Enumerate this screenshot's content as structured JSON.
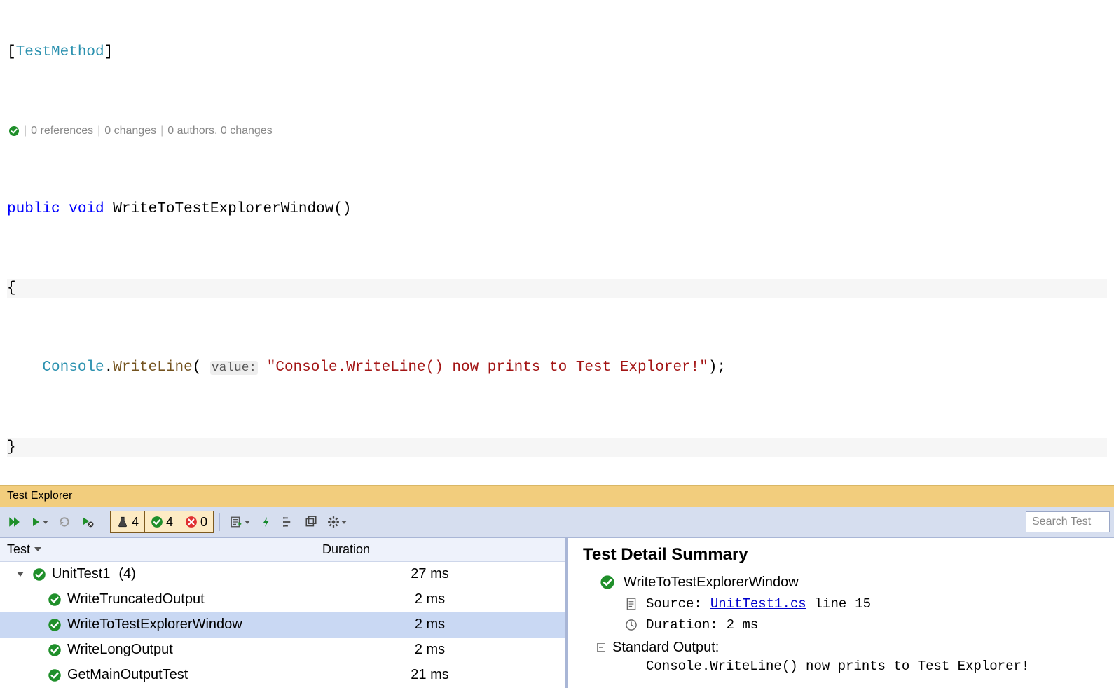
{
  "code": {
    "attribute": "TestMethod",
    "codelens": {
      "references": "0 references",
      "changes1": "0 changes",
      "authors": "0 authors, 0 changes"
    },
    "keyword_public": "public",
    "keyword_void": "void",
    "method_name": "WriteToTestExplorerWindow",
    "console_class": "Console",
    "writeline_call": "WriteLine",
    "param_hint": "value:",
    "string_literal": "\"Console.WriteLine() now prints to Test Explorer!\""
  },
  "panel": {
    "title": "Test Explorer"
  },
  "toolbar": {
    "counts": {
      "total": "4",
      "passed": "4",
      "failed": "0"
    },
    "search_placeholder": "Search Test"
  },
  "tree": {
    "columns": {
      "test": "Test",
      "duration": "Duration"
    },
    "group": {
      "name": "UnitTest1",
      "count": "(4)",
      "duration": "27 ms"
    },
    "tests": [
      {
        "name": "WriteTruncatedOutput",
        "duration": "2 ms",
        "selected": false
      },
      {
        "name": "WriteToTestExplorerWindow",
        "duration": "2 ms",
        "selected": true
      },
      {
        "name": "WriteLongOutput",
        "duration": "2 ms",
        "selected": false
      },
      {
        "name": "GetMainOutputTest",
        "duration": "21 ms",
        "selected": false
      }
    ]
  },
  "detail": {
    "title": "Test Detail Summary",
    "test_name": "WriteToTestExplorerWindow",
    "source_label": "Source:",
    "source_file": "UnitTest1.cs",
    "source_line_label": "line",
    "source_line": "15",
    "duration_label": "Duration:",
    "duration_value": "2 ms",
    "stdout_label": "Standard Output:",
    "stdout_value": "Console.WriteLine() now prints to Test Explorer!"
  }
}
